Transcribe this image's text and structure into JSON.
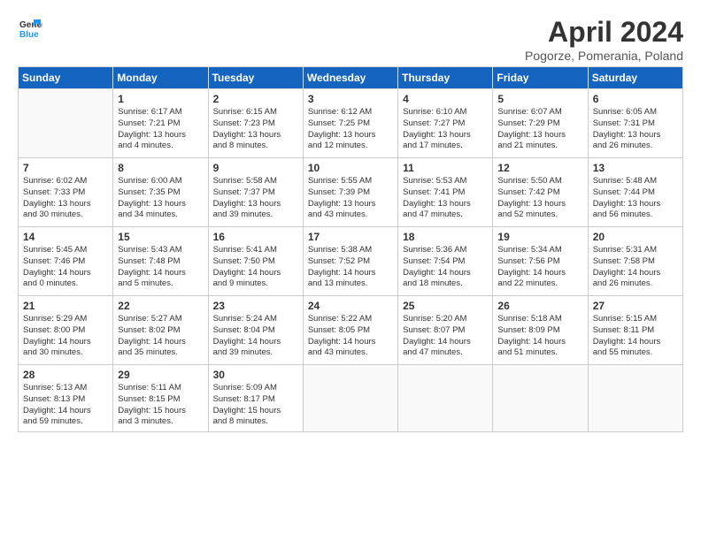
{
  "header": {
    "logo_line1": "General",
    "logo_line2": "Blue",
    "title": "April 2024",
    "location": "Pogorze, Pomerania, Poland"
  },
  "days_of_week": [
    "Sunday",
    "Monday",
    "Tuesday",
    "Wednesday",
    "Thursday",
    "Friday",
    "Saturday"
  ],
  "weeks": [
    [
      {
        "num": "",
        "info": ""
      },
      {
        "num": "1",
        "info": "Sunrise: 6:17 AM\nSunset: 7:21 PM\nDaylight: 13 hours\nand 4 minutes."
      },
      {
        "num": "2",
        "info": "Sunrise: 6:15 AM\nSunset: 7:23 PM\nDaylight: 13 hours\nand 8 minutes."
      },
      {
        "num": "3",
        "info": "Sunrise: 6:12 AM\nSunset: 7:25 PM\nDaylight: 13 hours\nand 12 minutes."
      },
      {
        "num": "4",
        "info": "Sunrise: 6:10 AM\nSunset: 7:27 PM\nDaylight: 13 hours\nand 17 minutes."
      },
      {
        "num": "5",
        "info": "Sunrise: 6:07 AM\nSunset: 7:29 PM\nDaylight: 13 hours\nand 21 minutes."
      },
      {
        "num": "6",
        "info": "Sunrise: 6:05 AM\nSunset: 7:31 PM\nDaylight: 13 hours\nand 26 minutes."
      }
    ],
    [
      {
        "num": "7",
        "info": "Sunrise: 6:02 AM\nSunset: 7:33 PM\nDaylight: 13 hours\nand 30 minutes."
      },
      {
        "num": "8",
        "info": "Sunrise: 6:00 AM\nSunset: 7:35 PM\nDaylight: 13 hours\nand 34 minutes."
      },
      {
        "num": "9",
        "info": "Sunrise: 5:58 AM\nSunset: 7:37 PM\nDaylight: 13 hours\nand 39 minutes."
      },
      {
        "num": "10",
        "info": "Sunrise: 5:55 AM\nSunset: 7:39 PM\nDaylight: 13 hours\nand 43 minutes."
      },
      {
        "num": "11",
        "info": "Sunrise: 5:53 AM\nSunset: 7:41 PM\nDaylight: 13 hours\nand 47 minutes."
      },
      {
        "num": "12",
        "info": "Sunrise: 5:50 AM\nSunset: 7:42 PM\nDaylight: 13 hours\nand 52 minutes."
      },
      {
        "num": "13",
        "info": "Sunrise: 5:48 AM\nSunset: 7:44 PM\nDaylight: 13 hours\nand 56 minutes."
      }
    ],
    [
      {
        "num": "14",
        "info": "Sunrise: 5:45 AM\nSunset: 7:46 PM\nDaylight: 14 hours\nand 0 minutes."
      },
      {
        "num": "15",
        "info": "Sunrise: 5:43 AM\nSunset: 7:48 PM\nDaylight: 14 hours\nand 5 minutes."
      },
      {
        "num": "16",
        "info": "Sunrise: 5:41 AM\nSunset: 7:50 PM\nDaylight: 14 hours\nand 9 minutes."
      },
      {
        "num": "17",
        "info": "Sunrise: 5:38 AM\nSunset: 7:52 PM\nDaylight: 14 hours\nand 13 minutes."
      },
      {
        "num": "18",
        "info": "Sunrise: 5:36 AM\nSunset: 7:54 PM\nDaylight: 14 hours\nand 18 minutes."
      },
      {
        "num": "19",
        "info": "Sunrise: 5:34 AM\nSunset: 7:56 PM\nDaylight: 14 hours\nand 22 minutes."
      },
      {
        "num": "20",
        "info": "Sunrise: 5:31 AM\nSunset: 7:58 PM\nDaylight: 14 hours\nand 26 minutes."
      }
    ],
    [
      {
        "num": "21",
        "info": "Sunrise: 5:29 AM\nSunset: 8:00 PM\nDaylight: 14 hours\nand 30 minutes."
      },
      {
        "num": "22",
        "info": "Sunrise: 5:27 AM\nSunset: 8:02 PM\nDaylight: 14 hours\nand 35 minutes."
      },
      {
        "num": "23",
        "info": "Sunrise: 5:24 AM\nSunset: 8:04 PM\nDaylight: 14 hours\nand 39 minutes."
      },
      {
        "num": "24",
        "info": "Sunrise: 5:22 AM\nSunset: 8:05 PM\nDaylight: 14 hours\nand 43 minutes."
      },
      {
        "num": "25",
        "info": "Sunrise: 5:20 AM\nSunset: 8:07 PM\nDaylight: 14 hours\nand 47 minutes."
      },
      {
        "num": "26",
        "info": "Sunrise: 5:18 AM\nSunset: 8:09 PM\nDaylight: 14 hours\nand 51 minutes."
      },
      {
        "num": "27",
        "info": "Sunrise: 5:15 AM\nSunset: 8:11 PM\nDaylight: 14 hours\nand 55 minutes."
      }
    ],
    [
      {
        "num": "28",
        "info": "Sunrise: 5:13 AM\nSunset: 8:13 PM\nDaylight: 14 hours\nand 59 minutes."
      },
      {
        "num": "29",
        "info": "Sunrise: 5:11 AM\nSunset: 8:15 PM\nDaylight: 15 hours\nand 3 minutes."
      },
      {
        "num": "30",
        "info": "Sunrise: 5:09 AM\nSunset: 8:17 PM\nDaylight: 15 hours\nand 8 minutes."
      },
      {
        "num": "",
        "info": ""
      },
      {
        "num": "",
        "info": ""
      },
      {
        "num": "",
        "info": ""
      },
      {
        "num": "",
        "info": ""
      }
    ]
  ]
}
